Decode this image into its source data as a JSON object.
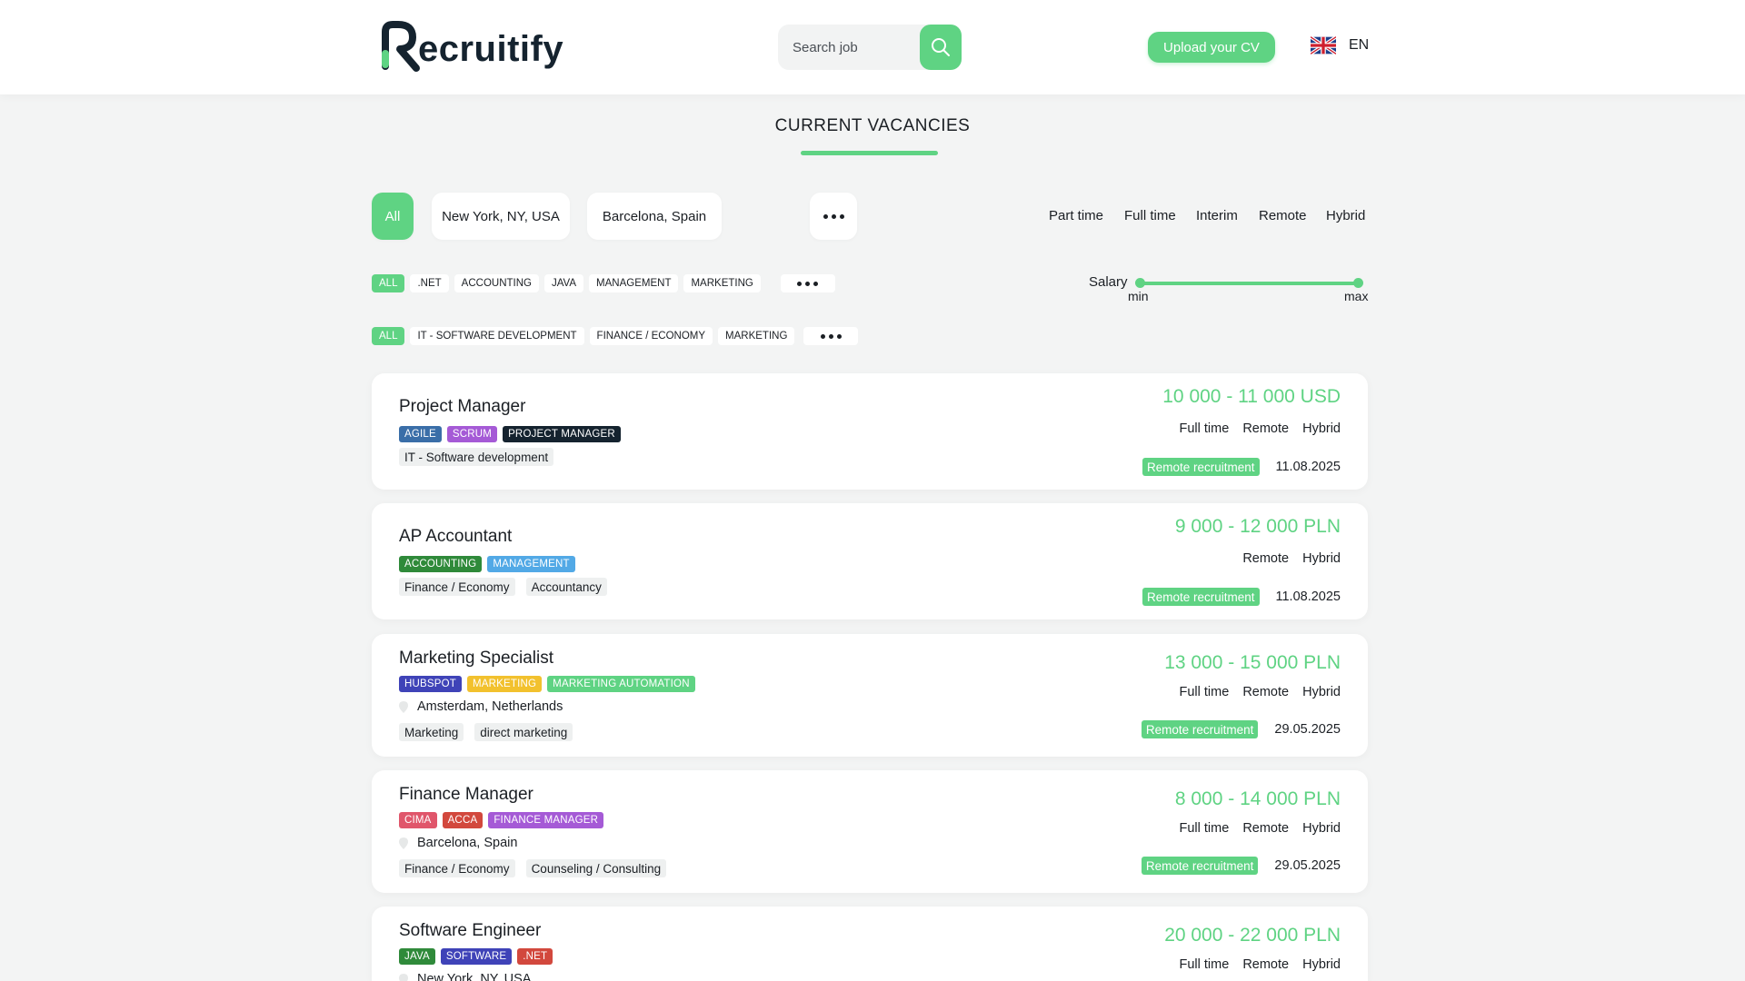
{
  "brand": {
    "name": "ecruitify"
  },
  "search": {
    "placeholder": "Search job"
  },
  "header": {
    "upload_label": "Upload your CV",
    "language": "EN"
  },
  "page": {
    "title": "CURRENT VACANCIES"
  },
  "filters": {
    "locations": [
      "All",
      "New York, NY, USA",
      "Barcelona, Spain"
    ],
    "work_types": [
      "Part time",
      "Full time",
      "Interim",
      "Remote",
      "Hybrid"
    ],
    "skills": [
      "ALL",
      ".NET",
      "ACCOUNTING",
      "JAVA",
      "MANAGEMENT",
      "MARKETING"
    ],
    "categories": [
      "ALL",
      "IT - SOFTWARE DEVELOPMENT",
      "FINANCE / ECONOMY",
      "MARKETING"
    ],
    "salary": {
      "label": "Salary",
      "min": "min",
      "max": "max"
    }
  },
  "jobs": [
    {
      "title": "Project Manager",
      "skills": [
        {
          "label": "AGILE",
          "color": "#3a6ea8"
        },
        {
          "label": "SCRUM",
          "color": "#a55ad6"
        },
        {
          "label": "PROJECT MANAGER",
          "color": "#15232f"
        }
      ],
      "location": "",
      "categories": [
        "IT - Software development"
      ],
      "salary": "10 000 - 11 000 USD",
      "types": [
        "Full time",
        "Remote",
        "Hybrid"
      ],
      "badge": "Remote recruitment",
      "date": "11.08.2025"
    },
    {
      "title": "AP Accountant",
      "skills": [
        {
          "label": "ACCOUNTING",
          "color": "#2f8a3a"
        },
        {
          "label": "MANAGEMENT",
          "color": "#52a9e6"
        }
      ],
      "location": "",
      "categories": [
        "Finance / Economy",
        "Accountancy"
      ],
      "salary": "9 000 - 12 000 PLN",
      "types": [
        "Remote",
        "Hybrid"
      ],
      "badge": "Remote recruitment",
      "date": "11.08.2025"
    },
    {
      "title": "Marketing Specialist",
      "skills": [
        {
          "label": "HUBSPOT",
          "color": "#3f43b8"
        },
        {
          "label": "MARKETING",
          "color": "#f2c12e"
        },
        {
          "label": "MARKETING AUTOMATION",
          "color": "#5fd383"
        }
      ],
      "location": "Amsterdam, Netherlands",
      "categories": [
        "Marketing",
        "direct marketing"
      ],
      "salary": "13 000 - 15 000 PLN",
      "types": [
        "Full time",
        "Remote",
        "Hybrid"
      ],
      "badge": "Remote recruitment",
      "date": "29.05.2025"
    },
    {
      "title": "Finance Manager",
      "skills": [
        {
          "label": "CIMA",
          "color": "#e0566b"
        },
        {
          "label": "ACCA",
          "color": "#d2483d"
        },
        {
          "label": "FINANCE MANAGER",
          "color": "#a55ad6"
        }
      ],
      "location": "Barcelona, Spain",
      "categories": [
        "Finance / Economy",
        "Counseling / Consulting"
      ],
      "salary": "8 000 - 14 000 PLN",
      "types": [
        "Full time",
        "Remote",
        "Hybrid"
      ],
      "badge": "Remote recruitment",
      "date": "29.05.2025"
    },
    {
      "title": "Software Engineer",
      "skills": [
        {
          "label": "JAVA",
          "color": "#2f8a3a"
        },
        {
          "label": "SOFTWARE",
          "color": "#3f43b8"
        },
        {
          "label": ".NET",
          "color": "#d2483d"
        }
      ],
      "location": "New York, NY, USA",
      "categories": [],
      "salary": "20 000 - 22 000 PLN",
      "types": [
        "Full time",
        "Remote",
        "Hybrid"
      ],
      "badge": "",
      "date": ""
    }
  ]
}
